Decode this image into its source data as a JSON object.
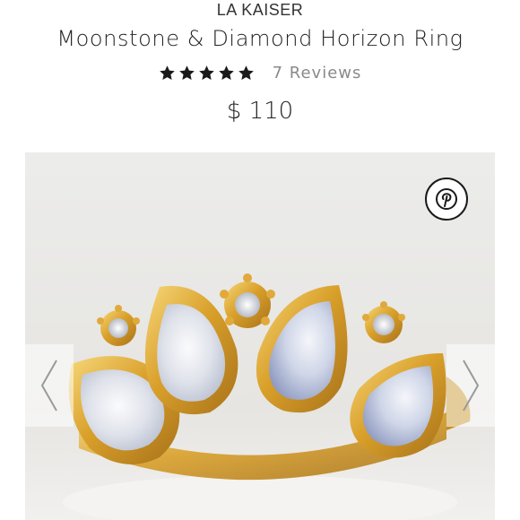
{
  "product": {
    "brand": "LA KAISER",
    "title": "Moonstone & Diamond Horizon Ring",
    "rating": 5,
    "rating_max": 5,
    "reviews_label": "7 Reviews",
    "price": "$ 110"
  },
  "gallery": {
    "image_alt": "Gold ring with pear-cut moonstones and diamond accents",
    "pin_icon": "pinterest-icon",
    "prev_icon": "chevron-left-icon",
    "next_icon": "chevron-right-icon"
  },
  "colors": {
    "star": "#1a1a1a",
    "reviews": "#8a8a8a",
    "gold": "#d9a02a",
    "image_bg": "#ebebe9"
  }
}
